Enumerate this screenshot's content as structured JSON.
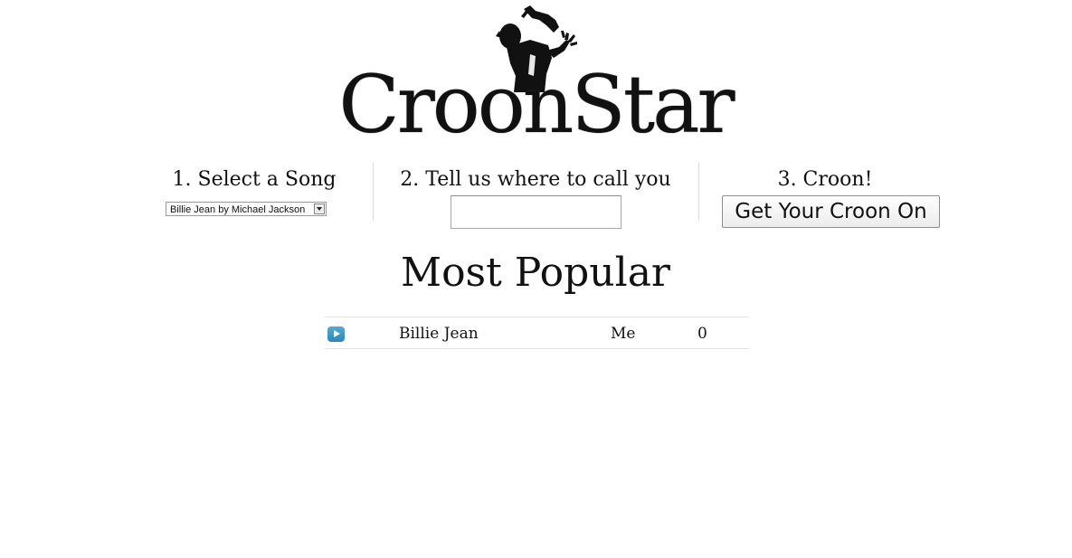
{
  "brand": {
    "name": "CroonStar"
  },
  "steps": {
    "select_song": {
      "title": "1. Select a Song",
      "selected_option": "Billie Jean by Michael Jackson"
    },
    "phone": {
      "title": "2. Tell us where to call you",
      "value": "",
      "placeholder": ""
    },
    "croon": {
      "title": "3. Croon!",
      "button_label": "Get Your Croon On"
    }
  },
  "popular": {
    "title": "Most Popular",
    "rows": [
      {
        "icon": "play-icon",
        "song": "Billie Jean",
        "singer": "Me",
        "count": "0"
      }
    ]
  },
  "colors": {
    "play_icon": "#3a98cb",
    "divider": "#d9d9d9"
  }
}
